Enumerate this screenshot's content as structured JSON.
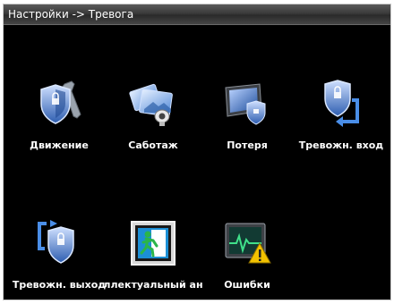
{
  "window": {
    "title": "Настройки -> Тревога"
  },
  "items": [
    {
      "label": "Движение",
      "icon": "shield-wrench-icon"
    },
    {
      "label": "Саботаж",
      "icon": "camera-cover-icon"
    },
    {
      "label": "Потеря",
      "icon": "monitor-shield-icon"
    },
    {
      "label": "Тревожн. вход",
      "icon": "shield-input-arrow-icon"
    },
    {
      "label": "Тревожн. выход",
      "icon": "shield-output-arrow-icon"
    },
    {
      "label": "ллектуальный ан",
      "icon": "exit-runner-icon"
    },
    {
      "label": "Ошибки",
      "icon": "heartbeat-warning-icon"
    }
  ],
  "colors": {
    "shield_blue": "#3a6fc4",
    "warning_yellow": "#f2c200",
    "exit_green": "#2bb54a"
  }
}
